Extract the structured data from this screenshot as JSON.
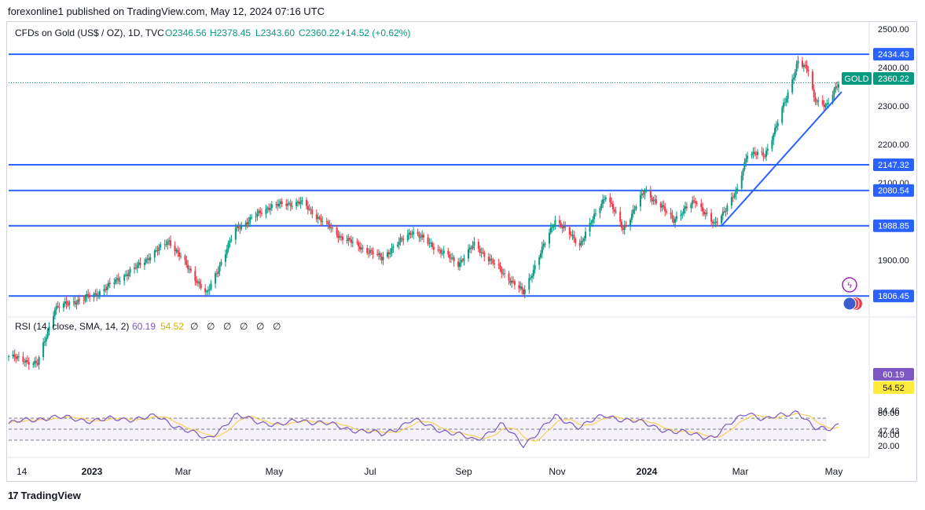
{
  "header": {
    "text": "forexonline1 published on TradingView.com, May 12, 2024 07:16 UTC"
  },
  "legend": {
    "symbol": "CFDs on Gold (US$ / OZ), 1D, TVC",
    "open": "O2346.56",
    "high": "H2378.45",
    "low": "L2343.60",
    "close": "C2360.22",
    "change": "+14.52 (+0.62%)"
  },
  "price_axis": {
    "ticks": [
      "2500.00",
      "2400.00",
      "2300.00",
      "2200.00",
      "2100.00",
      "1900.00"
    ]
  },
  "levels": [
    {
      "value": 2434.43,
      "label": "2434.43"
    },
    {
      "value": 2147.32,
      "label": "2147.32"
    },
    {
      "value": 2080.54,
      "label": "2080.54"
    },
    {
      "value": 1988.85,
      "label": "1988.85"
    },
    {
      "value": 1806.45,
      "label": "1806.45"
    }
  ],
  "last_price": {
    "symbol": "GOLD",
    "value": 2360.22,
    "label": "2360.22"
  },
  "rsi": {
    "label": "RSI (14, close, SMA, 14, 2)",
    "value": "60.19",
    "sma_value": "54.52",
    "na_values": [
      "∅",
      "∅",
      "∅",
      "∅",
      "∅",
      "∅"
    ],
    "axis_ticks": [
      "84.46",
      "80.00",
      "47.43",
      "40.00",
      "20.00"
    ],
    "upper_band": 70,
    "middle": 50,
    "lower_band": 30
  },
  "time_axis": [
    "14",
    "2023",
    "Mar",
    "May",
    "Jul",
    "Sep",
    "Nov",
    "2024",
    "Mar",
    "May"
  ],
  "colors": {
    "up": "#089981",
    "down": "#f23645",
    "level": "#2962ff",
    "rsi": "#7e57c2",
    "sma": "#f7d25c"
  },
  "branding": {
    "logo": "TradingView"
  },
  "chart_data": {
    "type": "candlestick",
    "title": "CFDs on Gold (US$ / OZ), 1D, TVC",
    "ylim": [
      1760,
      2510
    ],
    "x_range": [
      "2022-10-14",
      "2024-05-10"
    ],
    "price_path": [
      [
        "2022-10-14",
        1650
      ],
      [
        "2022-11-03",
        1630
      ],
      [
        "2022-11-15",
        1775
      ],
      [
        "2022-12-13",
        1810
      ],
      [
        "2023-01-10",
        1880
      ],
      [
        "2023-02-02",
        1950
      ],
      [
        "2023-02-28",
        1810
      ],
      [
        "2023-03-20",
        1980
      ],
      [
        "2023-04-13",
        2040
      ],
      [
        "2023-05-04",
        2050
      ],
      [
        "2023-05-31",
        1962
      ],
      [
        "2023-06-29",
        1905
      ],
      [
        "2023-07-20",
        1975
      ],
      [
        "2023-08-21",
        1890
      ],
      [
        "2023-09-01",
        1940
      ],
      [
        "2023-10-05",
        1815
      ],
      [
        "2023-10-27",
        2005
      ],
      [
        "2023-11-13",
        1940
      ],
      [
        "2023-12-01",
        2070
      ],
      [
        "2023-12-13",
        1980
      ],
      [
        "2023-12-28",
        2080
      ],
      [
        "2024-01-17",
        2005
      ],
      [
        "2024-02-01",
        2055
      ],
      [
        "2024-02-14",
        1990
      ],
      [
        "2024-03-01",
        2080
      ],
      [
        "2024-03-08",
        2180
      ],
      [
        "2024-03-20",
        2170
      ],
      [
        "2024-04-05",
        2330
      ],
      [
        "2024-04-12",
        2420
      ],
      [
        "2024-04-19",
        2390
      ],
      [
        "2024-04-23",
        2320
      ],
      [
        "2024-05-02",
        2300
      ],
      [
        "2024-05-10",
        2360.22
      ]
    ],
    "rsi_path": [
      [
        "2022-10-14",
        60
      ],
      [
        "2022-11-10",
        72
      ],
      [
        "2022-12-13",
        66
      ],
      [
        "2023-01-25",
        72
      ],
      [
        "2023-02-28",
        31
      ],
      [
        "2023-03-20",
        74
      ],
      [
        "2023-04-20",
        56
      ],
      [
        "2023-05-04",
        68
      ],
      [
        "2023-06-29",
        40
      ],
      [
        "2023-07-20",
        66
      ],
      [
        "2023-09-01",
        30
      ],
      [
        "2023-09-20",
        58
      ],
      [
        "2023-10-05",
        22
      ],
      [
        "2023-10-27",
        72
      ],
      [
        "2023-11-13",
        55
      ],
      [
        "2023-12-01",
        75
      ],
      [
        "2023-12-28",
        60
      ],
      [
        "2024-01-17",
        45
      ],
      [
        "2024-02-14",
        36
      ],
      [
        "2024-03-08",
        83
      ],
      [
        "2024-03-20",
        66
      ],
      [
        "2024-04-12",
        84
      ],
      [
        "2024-04-23",
        50
      ],
      [
        "2024-05-02",
        49
      ],
      [
        "2024-05-10",
        60.19
      ]
    ]
  }
}
